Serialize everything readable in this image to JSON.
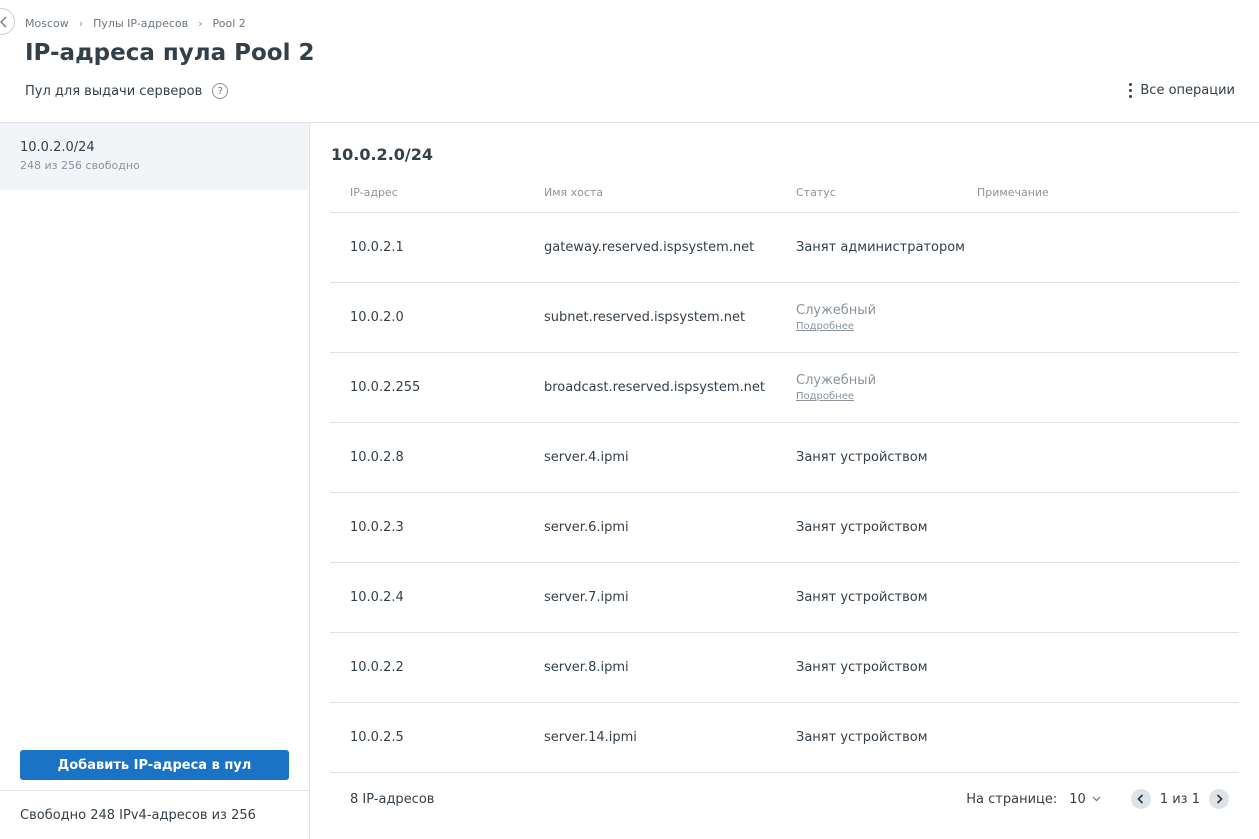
{
  "breadcrumb": [
    "Moscow",
    "Пулы IP-адресов",
    "Pool 2"
  ],
  "page_title": "IP-адреса пула Pool 2",
  "subtitle": "Пул для выдачи серверов",
  "help_glyph": "?",
  "all_operations": "Все операции",
  "sidebar": {
    "subnet_name": "10.0.2.0/24",
    "subnet_free": "248 из 256 свободно",
    "add_button": "Добавить IP-адреса в пул",
    "footer": "Свободно 248 IPv4-адресов из 256"
  },
  "main": {
    "section_title": "10.0.2.0/24",
    "columns": [
      "IP-адрес",
      "Имя хоста",
      "Статус",
      "Примечание"
    ],
    "rows": [
      {
        "ip": "10.0.2.1",
        "host": "gateway.reserved.ispsystem.net",
        "status": "Занят администратором",
        "link": ""
      },
      {
        "ip": "10.0.2.0",
        "host": "subnet.reserved.ispsystem.net",
        "status": "Служебный",
        "link": "Подробнее"
      },
      {
        "ip": "10.0.2.255",
        "host": "broadcast.reserved.ispsystem.net",
        "status": "Служебный",
        "link": "Подробнее"
      },
      {
        "ip": "10.0.2.8",
        "host": "server.4.ipmi",
        "status": "Занят устройством",
        "link": ""
      },
      {
        "ip": "10.0.2.3",
        "host": "server.6.ipmi",
        "status": "Занят устройством",
        "link": ""
      },
      {
        "ip": "10.0.2.4",
        "host": "server.7.ipmi",
        "status": "Занят устройством",
        "link": ""
      },
      {
        "ip": "10.0.2.2",
        "host": "server.8.ipmi",
        "status": "Занят устройством",
        "link": ""
      },
      {
        "ip": "10.0.2.5",
        "host": "server.14.ipmi",
        "status": "Занят устройством",
        "link": ""
      }
    ],
    "footer": {
      "count": "8 IP-адресов",
      "per_page_label": "На странице:",
      "per_page_value": "10",
      "page_info": "1 из 1"
    }
  },
  "colors": {
    "accent": "#1a73c4",
    "text": "#343f48",
    "muted": "#8a939b",
    "selected_bg": "#f2f5f8",
    "divider": "#dfe3e7"
  },
  "icons": [
    "back-arrow-icon",
    "help-icon",
    "more-vertical-icon",
    "chevron-down-icon",
    "chevron-left-icon",
    "chevron-right-icon"
  ]
}
